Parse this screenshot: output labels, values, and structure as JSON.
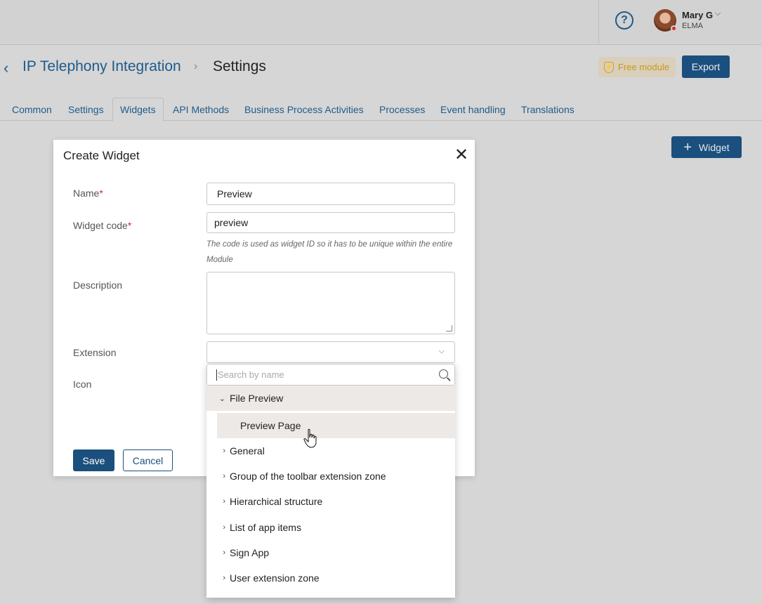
{
  "header": {
    "help_icon": "question-circle-icon",
    "user": {
      "name": "Mary G",
      "company": "ELMA"
    }
  },
  "page": {
    "app_name": "IP Telephony Integration",
    "separator": "›",
    "title": "Settings",
    "badge": "Free module",
    "export_label": "Export"
  },
  "tabs": [
    {
      "label": "Common"
    },
    {
      "label": "Settings"
    },
    {
      "label": "Widgets",
      "active": true
    },
    {
      "label": "API Methods"
    },
    {
      "label": "Business Process Activities"
    },
    {
      "label": "Processes"
    },
    {
      "label": "Event handling"
    },
    {
      "label": "Translations"
    }
  ],
  "add_widget_label": "Widget",
  "modal": {
    "title": "Create Widget",
    "fields": {
      "name": {
        "label": "Name",
        "value": "Preview"
      },
      "code": {
        "label": "Widget code",
        "value": "preview",
        "hint": "The code is used as widget ID so it has to be unique within the entire Module"
      },
      "description": {
        "label": "Description",
        "value": ""
      },
      "extension": {
        "label": "Extension",
        "value": ""
      },
      "icon": {
        "label": "Icon"
      }
    },
    "save_label": "Save",
    "cancel_label": "Cancel"
  },
  "dropdown": {
    "search_placeholder": "Search by name",
    "items": [
      {
        "label": "File Preview",
        "expanded": true
      },
      {
        "label": "Preview Page",
        "child": true
      },
      {
        "label": "General"
      },
      {
        "label": "Group of the toolbar extension zone"
      },
      {
        "label": "Hierarchical structure"
      },
      {
        "label": "List of app items"
      },
      {
        "label": "Sign App"
      },
      {
        "label": "User extension zone"
      }
    ]
  },
  "colors": {
    "primary": "#1b4f7d",
    "link": "#1e5b8c",
    "badge": "#c89a1c"
  }
}
